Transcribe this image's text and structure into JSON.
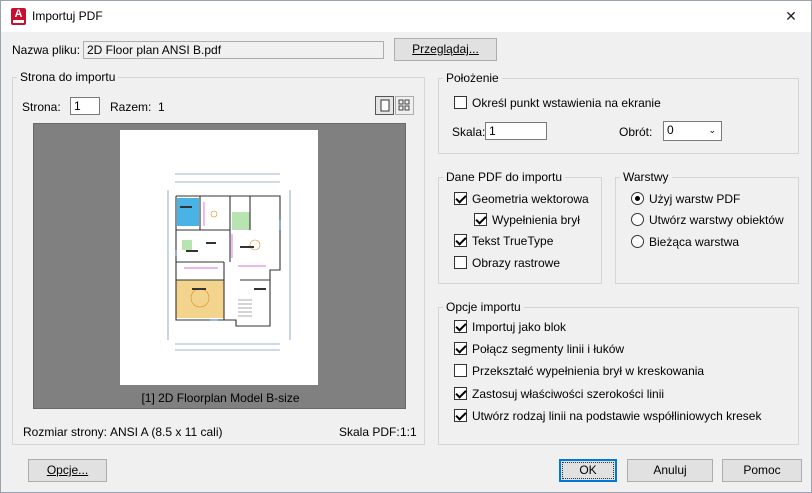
{
  "window": {
    "title": "Importuj PDF",
    "app_icon_letter": "A"
  },
  "file": {
    "label": "Nazwa pliku:",
    "value": "2D Floor plan ANSI B.pdf",
    "browse_label": "Przeglądaj..."
  },
  "page_group": {
    "title": "Strona do importu",
    "page_label": "Strona:",
    "page_value": "1",
    "total_label": "Razem:",
    "total_value": "1",
    "thumbnail_caption": "[1] 2D Floorplan Model B-size",
    "page_size_label": "Rozmiar strony:",
    "page_size_value": "ANSI A (8.5 x 11 cali)",
    "pdf_scale_label": "Skala PDF:",
    "pdf_scale_value": "1:1"
  },
  "location": {
    "title": "Położenie",
    "specify_on_screen_label": "Określ punkt wstawienia na ekranie",
    "specify_on_screen_checked": false,
    "scale_label": "Skala:",
    "scale_value": "1",
    "rotation_label": "Obrót:",
    "rotation_value": "0"
  },
  "pdf_data": {
    "title": "Dane PDF do importu",
    "items": [
      {
        "label": "Geometria wektorowa",
        "checked": true
      },
      {
        "label": "Wypełnienia brył",
        "checked": true
      },
      {
        "label": "Tekst TrueType",
        "checked": true
      },
      {
        "label": "Obrazy rastrowe",
        "checked": false
      }
    ]
  },
  "layers": {
    "title": "Warstwy",
    "options": [
      {
        "label": "Użyj warstw PDF",
        "selected": true
      },
      {
        "label": "Utwórz warstwy obiektów",
        "selected": false
      },
      {
        "label": "Bieżąca warstwa",
        "selected": false
      }
    ]
  },
  "import_options": {
    "title": "Opcje importu",
    "items": [
      {
        "label": "Importuj jako blok",
        "checked": true
      },
      {
        "label": "Połącz segmenty linii i łuków",
        "checked": true
      },
      {
        "label": "Przekształć wypełnienia brył w kreskowania",
        "checked": false
      },
      {
        "label": "Zastosuj właściwości szerokości linii",
        "checked": true
      },
      {
        "label": "Utwórz rodzaj linii na podstawie współliniowych kresek",
        "checked": true
      }
    ]
  },
  "buttons": {
    "options": "Opcje...",
    "ok": "OK",
    "cancel": "Anuluj",
    "help": "Pomoc"
  },
  "colors": {
    "accent": "#0078d7",
    "app_icon": "#c8102e",
    "plan_room_blue": "#49b3e6",
    "plan_room_yellow": "#f3d48c",
    "plan_room_green": "#b7e4b0"
  }
}
